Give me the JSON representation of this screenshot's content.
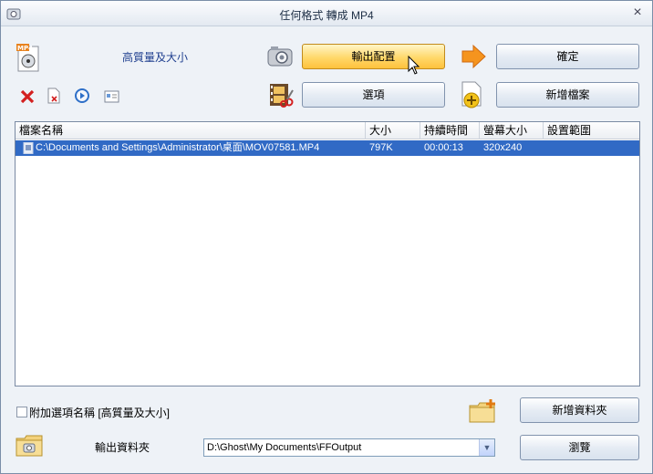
{
  "window": {
    "title": "任何格式 轉成 MP4"
  },
  "profile": {
    "quality_label": "高質量及大小"
  },
  "buttons": {
    "output_config": "輸出配置",
    "ok": "確定",
    "options": "選項",
    "add_file": "新增檔案",
    "add_folder": "新增資料夾",
    "browse": "瀏覽"
  },
  "table": {
    "columns": [
      "檔案名稱",
      "大小",
      "持續時間",
      "螢幕大小",
      "設置範圍"
    ],
    "rows": [
      {
        "name": "C:\\Documents and Settings\\Administrator\\桌面\\MOV07581.MP4",
        "size": "797K",
        "duration": "00:00:13",
        "screen": "320x240",
        "range": ""
      }
    ]
  },
  "bottom": {
    "append_option_label": "附加選項名稱 [高質量及大小]",
    "output_folder_label": "輸出資料夾",
    "output_folder_value": "D:\\Ghost\\My Documents\\FFOutput"
  },
  "icons": [
    "mp4-icon",
    "remove-icon",
    "clear-icon",
    "play-icon",
    "info-icon",
    "config-icon",
    "arrow-right-icon",
    "scissors-film-icon",
    "add-file-icon",
    "add-folder-icon",
    "folder-icon",
    "close-icon"
  ]
}
